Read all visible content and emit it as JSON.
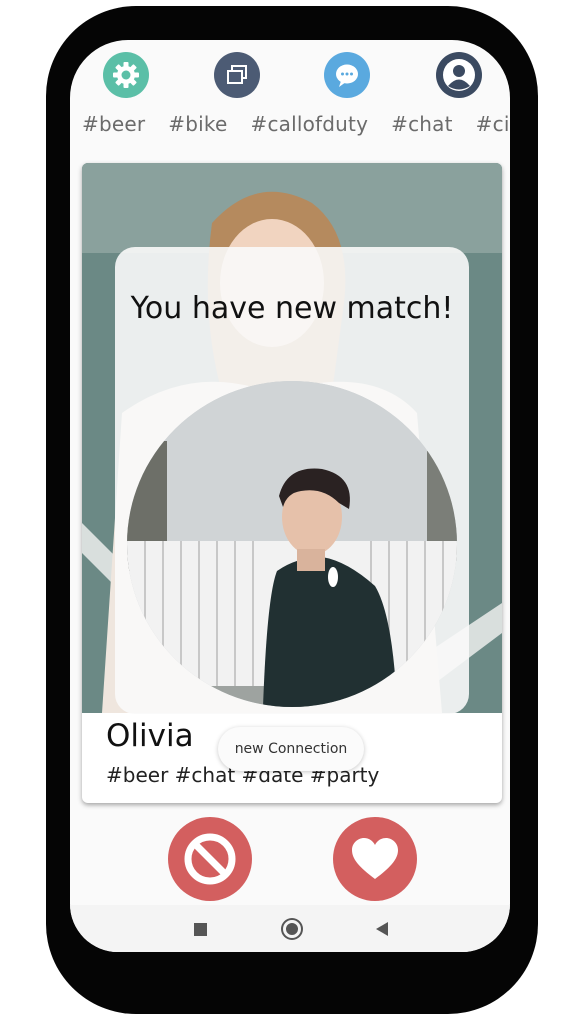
{
  "nav": {
    "icons": [
      {
        "name": "settings-icon",
        "color": "#5bbfa7"
      },
      {
        "name": "cards-icon",
        "color": "#4c5b74"
      },
      {
        "name": "chat-icon",
        "color": "#5aa9df"
      },
      {
        "name": "profile-icon",
        "color": "#3b4a61"
      }
    ],
    "tags": [
      "#beer",
      "#bike",
      "#callofduty",
      "#chat",
      "#cine"
    ]
  },
  "card": {
    "name": "Olivia",
    "tags": "#beer #chat #date #party"
  },
  "match": {
    "title": "You have new match!"
  },
  "toast": {
    "text": "new Connection"
  },
  "actions": {
    "reject_icon": "block-icon",
    "like_icon": "heart-icon",
    "color": "#d35f5f"
  },
  "system_nav": {
    "buttons": [
      "recents-square-icon",
      "home-circle-icon",
      "back-triangle-icon"
    ]
  }
}
